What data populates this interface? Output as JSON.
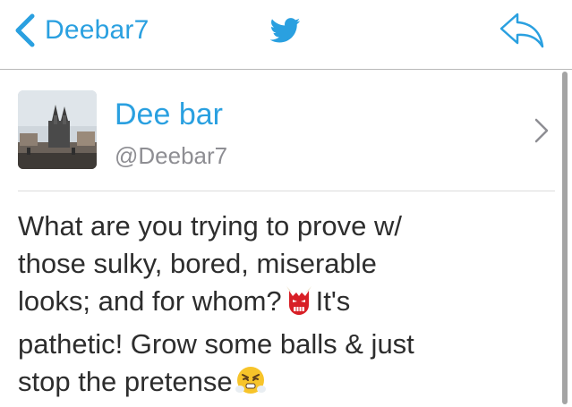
{
  "nav": {
    "back_label": "Deebar7",
    "accent": "#2aa0e0",
    "center_icon": "twitter-bird-icon",
    "right_icon": "reply-arrow-icon"
  },
  "profile": {
    "display_name": "Dee bar",
    "handle": "@Deebar7",
    "avatar_icon": "avatar-photo-church"
  },
  "tweet": {
    "line1": "What are you trying to prove w/",
    "line2": "those sulky, bored, miserable",
    "line3_a": "looks; and for whom?",
    "line3_b": "It's",
    "line4": "pathetic! Grow some balls & just",
    "line5": "stop the pretense",
    "emoji_1": "japanese-ogre-emoji",
    "emoji_2": "face-with-steam-emoji"
  }
}
